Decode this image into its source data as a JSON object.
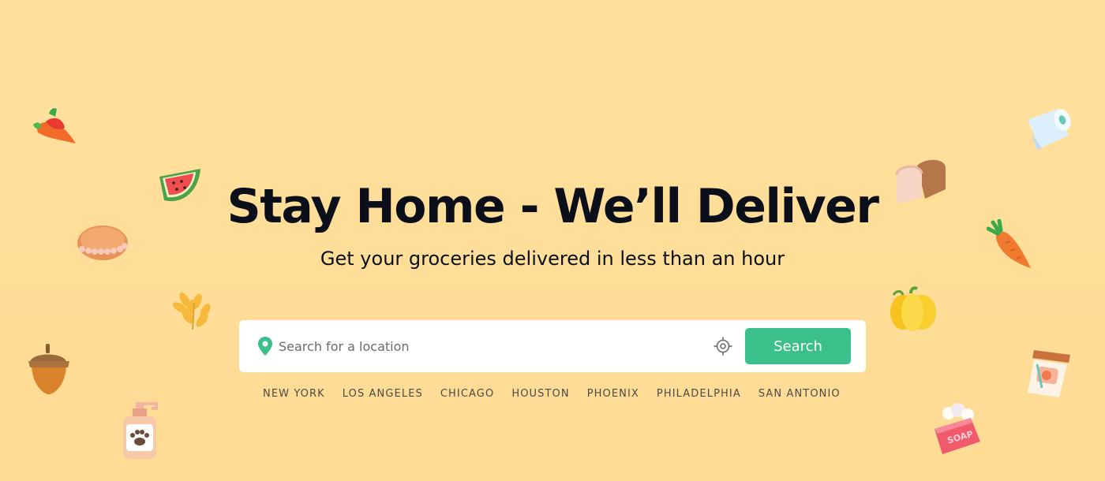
{
  "hero": {
    "title": "Stay Home - We’ll Deliver",
    "subtitle": "Get your groceries delivered in less than an hour"
  },
  "search": {
    "placeholder": "Search for a location",
    "value": "",
    "button_label": "Search"
  },
  "cities": [
    "NEW YORK",
    "LOS ANGELES",
    "CHICAGO",
    "HOUSTON",
    "PHOENIX",
    "PHILADELPHIA",
    "SAN ANTONIO"
  ],
  "decorations": [
    "chili-pepper-icon",
    "watermelon-icon",
    "bread-bun-icon",
    "wheat-icon",
    "acorn-icon",
    "pet-shampoo-bottle-icon",
    "toilet-paper-icon",
    "bread-loaf-icon",
    "carrot-icon",
    "pumpkin-icon",
    "coffee-cup-icon",
    "soap-icon"
  ],
  "colors": {
    "background": "#FFE19C",
    "accent": "#3BBF8B",
    "pin": "#3BBF8B",
    "title": "#0b0f1a"
  }
}
